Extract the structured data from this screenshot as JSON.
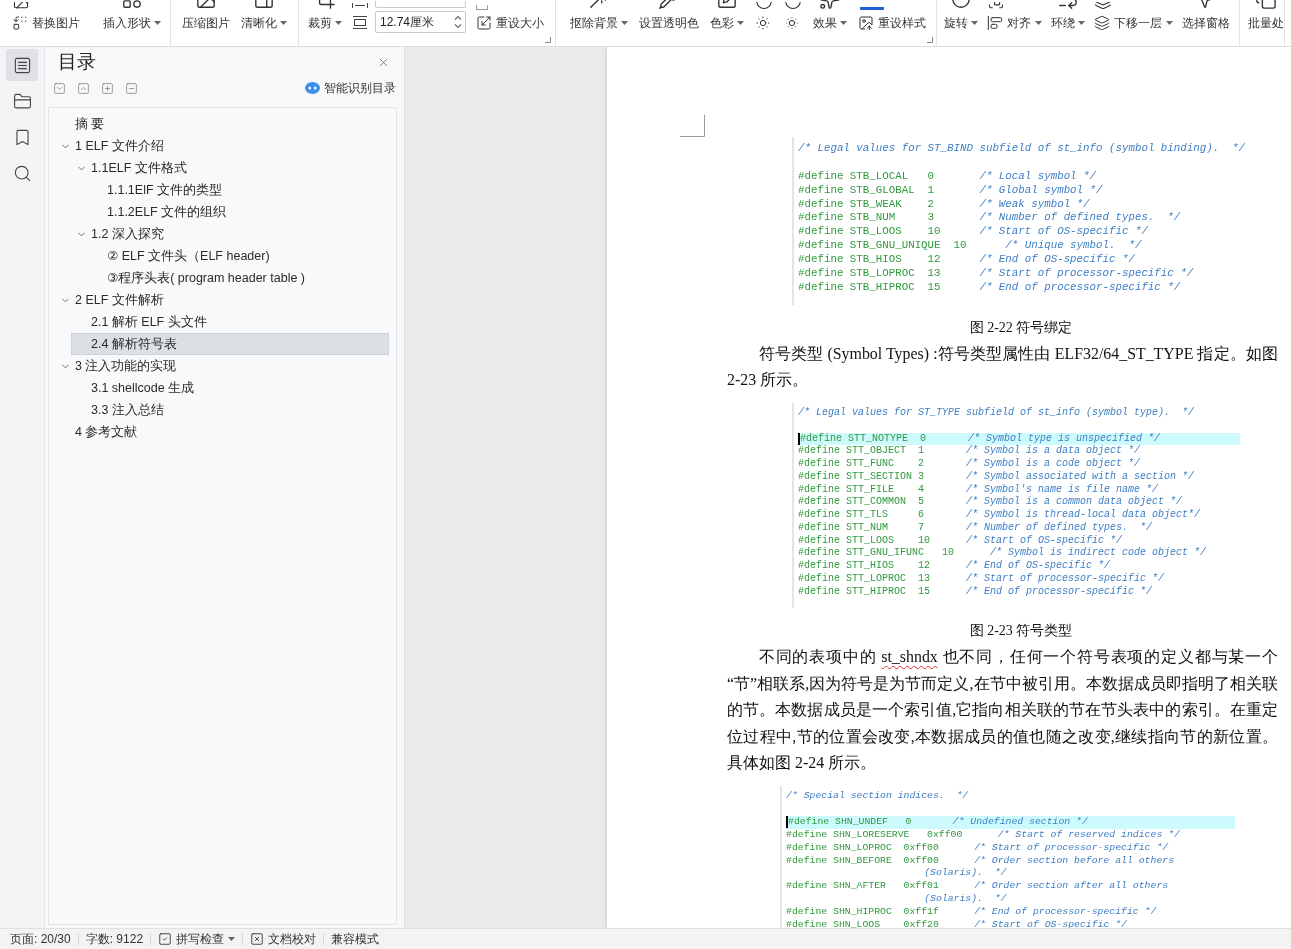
{
  "toolbar": {
    "groups": [
      {
        "launcher": false,
        "items": [
          {
            "kind": "small",
            "label": "替换图片",
            "dropdown": false
          },
          {
            "kind": "large",
            "label": "插入形状",
            "dropdown": true
          }
        ]
      },
      {
        "launcher": false,
        "items": [
          {
            "kind": "large",
            "label": "压缩图片",
            "dropdown": false
          },
          {
            "kind": "large",
            "label": "清晰化",
            "dropdown": true
          }
        ]
      },
      {
        "launcher": true,
        "items": [
          {
            "kind": "large",
            "label": "裁剪",
            "dropdown": true
          },
          {
            "kind": "size",
            "value": "12.74厘米"
          },
          {
            "kind": "small",
            "label": "重设大小",
            "dropdown": false
          }
        ]
      },
      {
        "launcher": true,
        "items": [
          {
            "kind": "large",
            "label": "抠除背景",
            "dropdown": true
          },
          {
            "kind": "large",
            "label": "设置透明色",
            "dropdown": false
          },
          {
            "kind": "large",
            "label": "色彩",
            "dropdown": true
          },
          {
            "kind": "icon"
          },
          {
            "kind": "icon"
          },
          {
            "kind": "large",
            "label": "效果",
            "dropdown": true
          },
          {
            "kind": "small",
            "label": "重设样式",
            "dropdown": false
          }
        ]
      },
      {
        "launcher": false,
        "items": [
          {
            "kind": "large",
            "label": "旋转",
            "dropdown": true
          },
          {
            "kind": "small",
            "label": "对齐",
            "dropdown": true
          },
          {
            "kind": "large",
            "label": "环绕",
            "dropdown": true
          },
          {
            "kind": "small",
            "label": "下移一层",
            "dropdown": true
          },
          {
            "kind": "large",
            "label": "选择窗格",
            "dropdown": false
          }
        ]
      },
      {
        "launcher": false,
        "items": [
          {
            "kind": "large",
            "label": "批量处",
            "dropdown": false
          }
        ]
      }
    ]
  },
  "rail": [
    {
      "selected": true
    },
    {
      "selected": false
    },
    {
      "selected": false
    },
    {
      "selected": false
    }
  ],
  "toc": {
    "title": "目录",
    "smart_button": "智能识别目录",
    "items": [
      {
        "label": "摘 要",
        "selected": false
      },
      {
        "label": "1 ELF 文件介绍",
        "expanded": true,
        "selected": false,
        "children": [
          {
            "label": "1.1ELF 文件格式",
            "expanded": true,
            "selected": false,
            "children": [
              {
                "label": "1.1.1ElF 文件的类型",
                "selected": false
              },
              {
                "label": "1.1.2ELF 文件的组织",
                "selected": false
              }
            ]
          },
          {
            "label": "1.2 深入探究",
            "expanded": true,
            "selected": false,
            "children": [
              {
                "label": "② ELF 文件头（ELF header)",
                "selected": false
              },
              {
                "label": "③程序头表( program header table )",
                "selected": false
              }
            ]
          }
        ]
      },
      {
        "label": "2 ELF 文件解析",
        "expanded": true,
        "selected": false,
        "children": [
          {
            "label": "2.1 解析 ELF 头文件",
            "selected": false
          },
          {
            "label": "2.4 解析符号表",
            "selected": true
          }
        ]
      },
      {
        "label": "3 注入功能的实现",
        "expanded": true,
        "selected": false,
        "children": [
          {
            "label": "3.1 shellcode 生成",
            "selected": false
          },
          {
            "label": "3.3 注入总结",
            "selected": false
          }
        ]
      },
      {
        "label": "4 参考文献",
        "selected": false
      }
    ]
  },
  "document": [
    {
      "kind": "code",
      "header": "/* Legal values for ST_BIND subfield of st_info (symbol binding).  */",
      "lines": [
        {
          "kind": "define",
          "name": "#define STB_LOCAL",
          "value": "0",
          "comment": "/* Local symbol */",
          "current": false
        },
        {
          "kind": "define",
          "name": "#define STB_GLOBAL",
          "value": "1",
          "comment": "/* Global symbol */",
          "current": false
        },
        {
          "kind": "define",
          "name": "#define STB_WEAK",
          "value": "2",
          "comment": "/* Weak symbol */",
          "current": false
        },
        {
          "kind": "define",
          "name": "#define STB_NUM",
          "value": "3",
          "comment": "/* Number of defined types.  */",
          "current": false
        },
        {
          "kind": "define",
          "name": "#define STB_LOOS",
          "value": "10",
          "comment": "/* Start of OS-specific */",
          "current": false
        },
        {
          "kind": "define",
          "name": "#define STB_GNU_UNIQUE",
          "value": "10",
          "comment": "/* Unique symbol.  */",
          "current": false
        },
        {
          "kind": "define",
          "name": "#define STB_HIOS",
          "value": "12",
          "comment": "/* End of OS-specific */",
          "current": false
        },
        {
          "kind": "define",
          "name": "#define STB_LOPROC",
          "value": "13",
          "comment": "/* Start of processor-specific */",
          "current": false
        },
        {
          "kind": "define",
          "name": "#define STB_HIPROC",
          "value": "15",
          "comment": "/* End of processor-specific */",
          "current": false
        }
      ]
    },
    {
      "kind": "caption",
      "text": "图 2-22 符号绑定"
    },
    {
      "kind": "paragraph",
      "runs": [
        {
          "text": "符号类型 (Symbol Types) :符号类型属性由 ELF32/64_ST_TYPE 指定。如图 2-23 所示。",
          "misspelled": false
        }
      ]
    },
    {
      "kind": "code",
      "header": "/* Legal values for ST_TYPE subfield of st_info (symbol type).  */",
      "lines": [
        {
          "kind": "define",
          "name": "#define STT_NOTYPE",
          "value": "0",
          "comment": "/* Symbol type is unspecified */",
          "current": true
        },
        {
          "kind": "define",
          "name": "#define STT_OBJECT",
          "value": "1",
          "comment": "/* Symbol is a data object */",
          "current": false
        },
        {
          "kind": "define",
          "name": "#define STT_FUNC",
          "value": "2",
          "comment": "/* Symbol is a code object */",
          "current": false
        },
        {
          "kind": "define",
          "name": "#define STT_SECTION",
          "value": "3",
          "comment": "/* Symbol associated with a section */",
          "current": false
        },
        {
          "kind": "define",
          "name": "#define STT_FILE",
          "value": "4",
          "comment": "/* Symbol's name is file name */",
          "current": false
        },
        {
          "kind": "define",
          "name": "#define STT_COMMON",
          "value": "5",
          "comment": "/* Symbol is a common data object */",
          "current": false
        },
        {
          "kind": "define",
          "name": "#define STT_TLS",
          "value": "6",
          "comment": "/* Symbol is thread-local data object*/",
          "current": false
        },
        {
          "kind": "define",
          "name": "#define STT_NUM",
          "value": "7",
          "comment": "/* Number of defined types.  */",
          "current": false
        },
        {
          "kind": "define",
          "name": "#define STT_LOOS",
          "value": "10",
          "comment": "/* Start of OS-specific */",
          "current": false
        },
        {
          "kind": "define",
          "name": "#define STT_GNU_IFUNC",
          "value": "10",
          "comment": "/* Symbol is indirect code object */",
          "current": false
        },
        {
          "kind": "define",
          "name": "#define STT_HIOS",
          "value": "12",
          "comment": "/* End of OS-specific */",
          "current": false
        },
        {
          "kind": "define",
          "name": "#define STT_LOPROC",
          "value": "13",
          "comment": "/* Start of processor-specific */",
          "current": false
        },
        {
          "kind": "define",
          "name": "#define STT_HIPROC",
          "value": "15",
          "comment": "/* End of processor-specific */",
          "current": false
        }
      ]
    },
    {
      "kind": "caption",
      "text": "图 2-23 符号类型"
    },
    {
      "kind": "paragraph",
      "runs": [
        {
          "text": "不同的表项中的 ",
          "misspelled": false
        },
        {
          "text": "st_shndx",
          "misspelled": true
        },
        {
          "text": " 也不同，任何一个符号表项的定义都与某一个",
          "misspelled": false
        },
        {
          "text": "“节”相联系,因为符号是为节而定义,在节中被引用。本数据成员即指明了相关联的节。本数据成员是一个索引值,它指向相关联的节在节头表中的索引。在重定位过程中,节的位置会改变,本数据成员的值也随之改变,继续指向节的新位置。具体如图 2-24 所示。",
          "misspelled": false
        }
      ]
    },
    {
      "kind": "code",
      "header": "/* Special section indices.  */",
      "lines": [
        {
          "kind": "define",
          "name": "#define SHN_UNDEF",
          "value": "0",
          "comment": "/* Undefined section */",
          "current": true
        },
        {
          "kind": "define",
          "name": "#define SHN_LORESERVE",
          "value": "0xff00",
          "comment": "/* Start of reserved indices */",
          "current": false
        },
        {
          "kind": "define",
          "name": "#define SHN_LOPROC",
          "value": "0xff00",
          "comment": "/* Start of processor-specific */",
          "current": false
        },
        {
          "kind": "define",
          "name": "#define SHN_BEFORE",
          "value": "0xff00",
          "comment": "/* Order section before all others",
          "current": false
        },
        {
          "kind": "continuation",
          "comment": "(Solaris).  */",
          "current": false
        },
        {
          "kind": "define",
          "name": "#define SHN_AFTER",
          "value": "0xff01",
          "comment": "/* Order section after all others",
          "current": false
        },
        {
          "kind": "continuation",
          "comment": "(Solaris).  */",
          "current": false
        },
        {
          "kind": "define",
          "name": "#define SHN_HIPROC",
          "value": "0xff1f",
          "comment": "/* End of processor-specific */",
          "current": false
        },
        {
          "kind": "define",
          "name": "#define SHN_LOOS",
          "value": "0xff20",
          "comment": "/* Start of OS-specific */",
          "current": false
        }
      ]
    }
  ],
  "status_bar": [
    {
      "kind": "text",
      "label": "页面: 20/30"
    },
    {
      "kind": "text",
      "label": "字数: 9122"
    },
    {
      "kind": "check",
      "label": "拼写检查",
      "dropdown": true
    },
    {
      "kind": "cross",
      "label": "文档校对"
    },
    {
      "kind": "text",
      "label": "兼容模式"
    }
  ]
}
